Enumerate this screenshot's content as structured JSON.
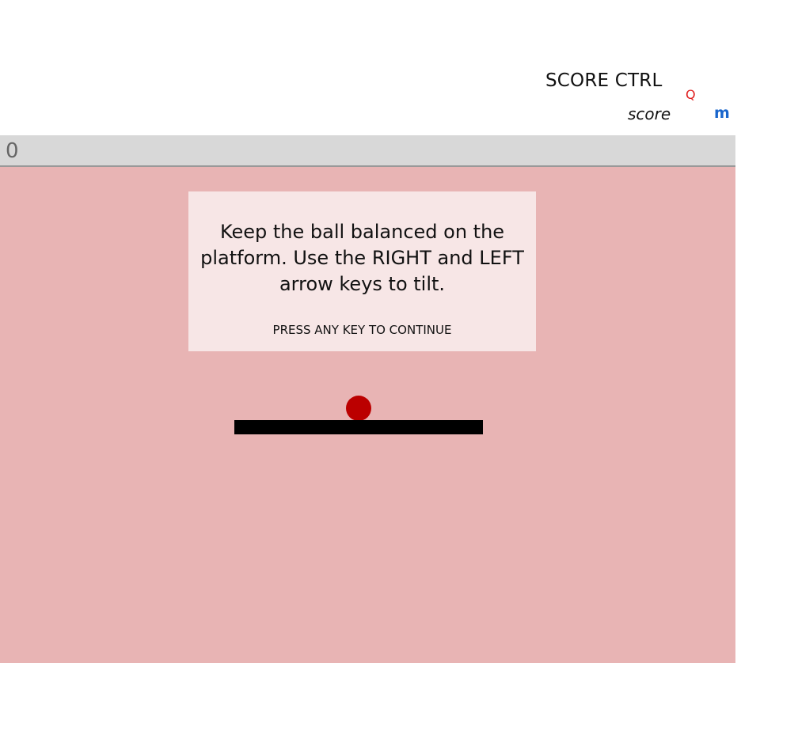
{
  "header": {
    "title": "SCORE CTRL",
    "q_label": "Q",
    "score_label": "score",
    "m_label": "m"
  },
  "score": {
    "value": "0"
  },
  "overlay": {
    "instructions": "Keep the ball balanced on the platform. Use the RIGHT and LEFT arrow keys to tilt.",
    "continue_prompt": "PRESS ANY KEY TO CONTINUE"
  },
  "colors": {
    "game_background": "#e8b4b4",
    "message_background": "#f7e6e6",
    "ball": "#bb0000",
    "platform": "#000000",
    "score_bar": "#d8d8d8",
    "q_label": "#e02020",
    "m_label": "#1a66cc"
  }
}
